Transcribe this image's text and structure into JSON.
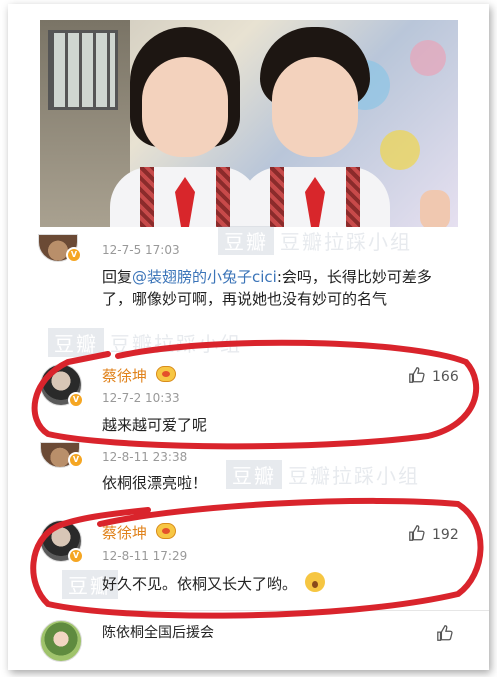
{
  "comments": [
    {
      "time": "12-7-5 17:03",
      "reply_prefix": "回复",
      "mention": "@装翅膀的小兔子cici",
      "text": ":会吗，长得比妙可差多了，哪像妙可啊，再说她也没有妙可的名气"
    },
    {
      "name": "蔡徐坤",
      "time": "12-7-2 10:33",
      "text": "越来越可爱了呢",
      "likes": "166"
    },
    {
      "time": "12-8-11 23:38",
      "text": "依桐很漂亮啦！"
    },
    {
      "name": "蔡徐坤",
      "time": "12-8-11 17:29",
      "text": "好久不见。依桐又长大了哟。",
      "likes": "192"
    },
    {
      "name": "陈依桐全国后援会"
    }
  ],
  "watermark": {
    "brand": "豆瓣",
    "group": "豆瓣拉踩小组"
  },
  "icons": {
    "like": "thumbs-up-icon",
    "verified": "verified-badge-icon",
    "vip": "crown-icon",
    "emoji": "sweat-smile-emoji-icon"
  },
  "colors": {
    "username": "#e0821b",
    "mention": "#3b74b8",
    "annotation_circle": "#d9242c",
    "verified_badge": "#f5a623"
  }
}
